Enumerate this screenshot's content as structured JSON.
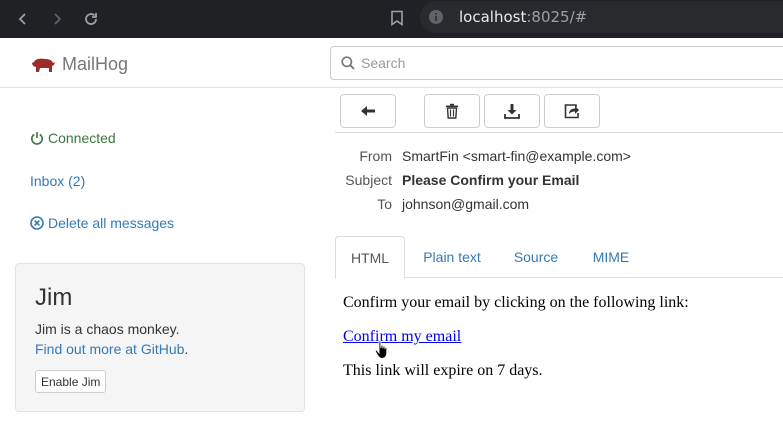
{
  "browser": {
    "url_host": "localhost",
    "url_rest": ":8025/#"
  },
  "app": {
    "brand": "MailHog",
    "search_placeholder": "Search"
  },
  "sidebar": {
    "connected": "Connected",
    "inbox": "Inbox (2)",
    "delete_all": "Delete all messages"
  },
  "jim": {
    "title": "Jim",
    "desc": "Jim is a chaos monkey.",
    "link": "Find out more at GitHub",
    "link_suffix": ".",
    "button": "Enable Jim"
  },
  "message": {
    "labels": {
      "from": "From",
      "subject": "Subject",
      "to": "To"
    },
    "from": "SmartFin <smart-fin@example.com>",
    "subject": "Please Confirm your Email",
    "to": "johnson@gmail.com"
  },
  "tabs": [
    "HTML",
    "Plain text",
    "Source",
    "MIME"
  ],
  "body": {
    "line1": "Confirm your email by clicking on the following link:",
    "link": "Confirm my email",
    "line3": "This link will expire on 7 days."
  },
  "colors": {
    "link": "#337ab7",
    "connected": "#3c763d",
    "brand_icon": "#9c2c2c"
  }
}
